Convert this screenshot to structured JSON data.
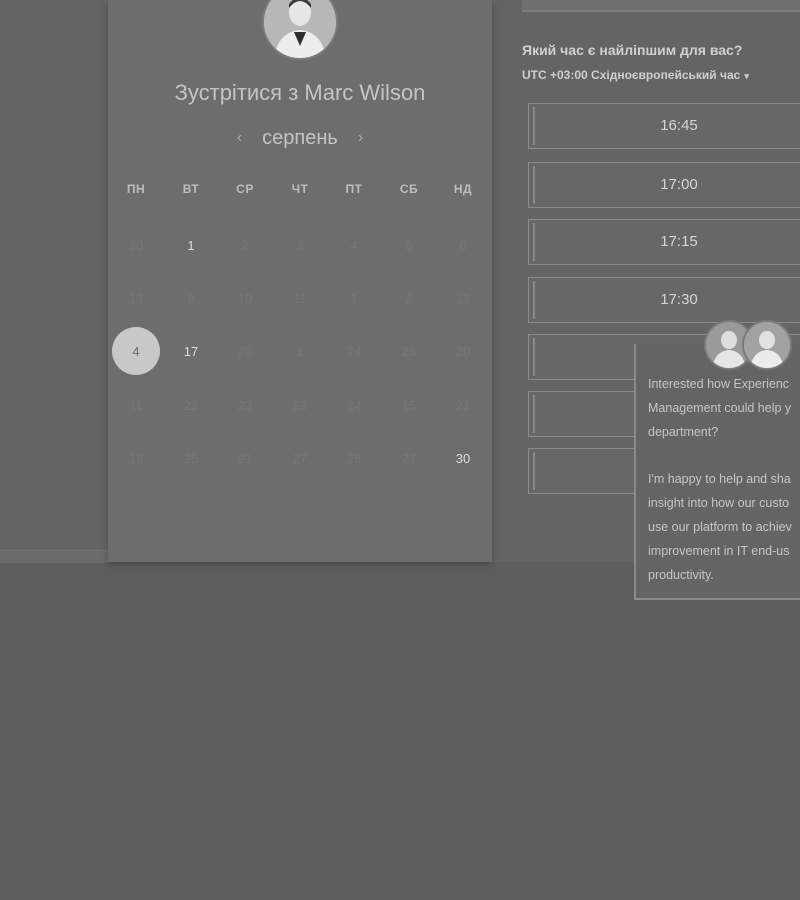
{
  "host": {
    "avatar_icon": "host-avatar-photo",
    "title": "Зустрітися з Marc Wilson"
  },
  "calendar": {
    "month": "серпень",
    "prev_icon": "chevron-left-icon",
    "next_icon": "chevron-right-icon",
    "weekdays": [
      "ПН",
      "ВТ",
      "СР",
      "ЧТ",
      "ПТ",
      "СБ",
      "НД"
    ],
    "weeks": [
      [
        "30",
        "1",
        "2",
        "3",
        "4",
        "5",
        "6"
      ],
      [
        "13",
        "9",
        "10",
        "11",
        "1",
        "2",
        "13"
      ],
      [
        "4",
        "17",
        "20",
        "1",
        "24",
        "25",
        "20"
      ],
      [
        "11",
        "22",
        "23",
        "23",
        "24",
        "15",
        "21"
      ],
      [
        "18",
        "25",
        "21",
        "27",
        "28",
        "27",
        "30"
      ]
    ],
    "available": [
      [
        0,
        1
      ],
      [
        2,
        1
      ],
      [
        4,
        6
      ]
    ],
    "selected": [
      2,
      0
    ]
  },
  "scheduler": {
    "question": "Який час є найліпшим для вас?",
    "timezone": "UTC +03:00 Східноєвропейський час",
    "timezone_caret": "▾",
    "slots": [
      "16:45",
      "17:00",
      "17:15",
      "17:30",
      "",
      "",
      ""
    ]
  },
  "chat": {
    "message_1": [
      "Interested how Experienc",
      "Management could help y",
      "department?"
    ],
    "message_2": [
      "I'm happy to help and sha",
      "insight into how our custo",
      "use our platform to achiev",
      "improvement in IT end-us",
      "productivity."
    ]
  }
}
